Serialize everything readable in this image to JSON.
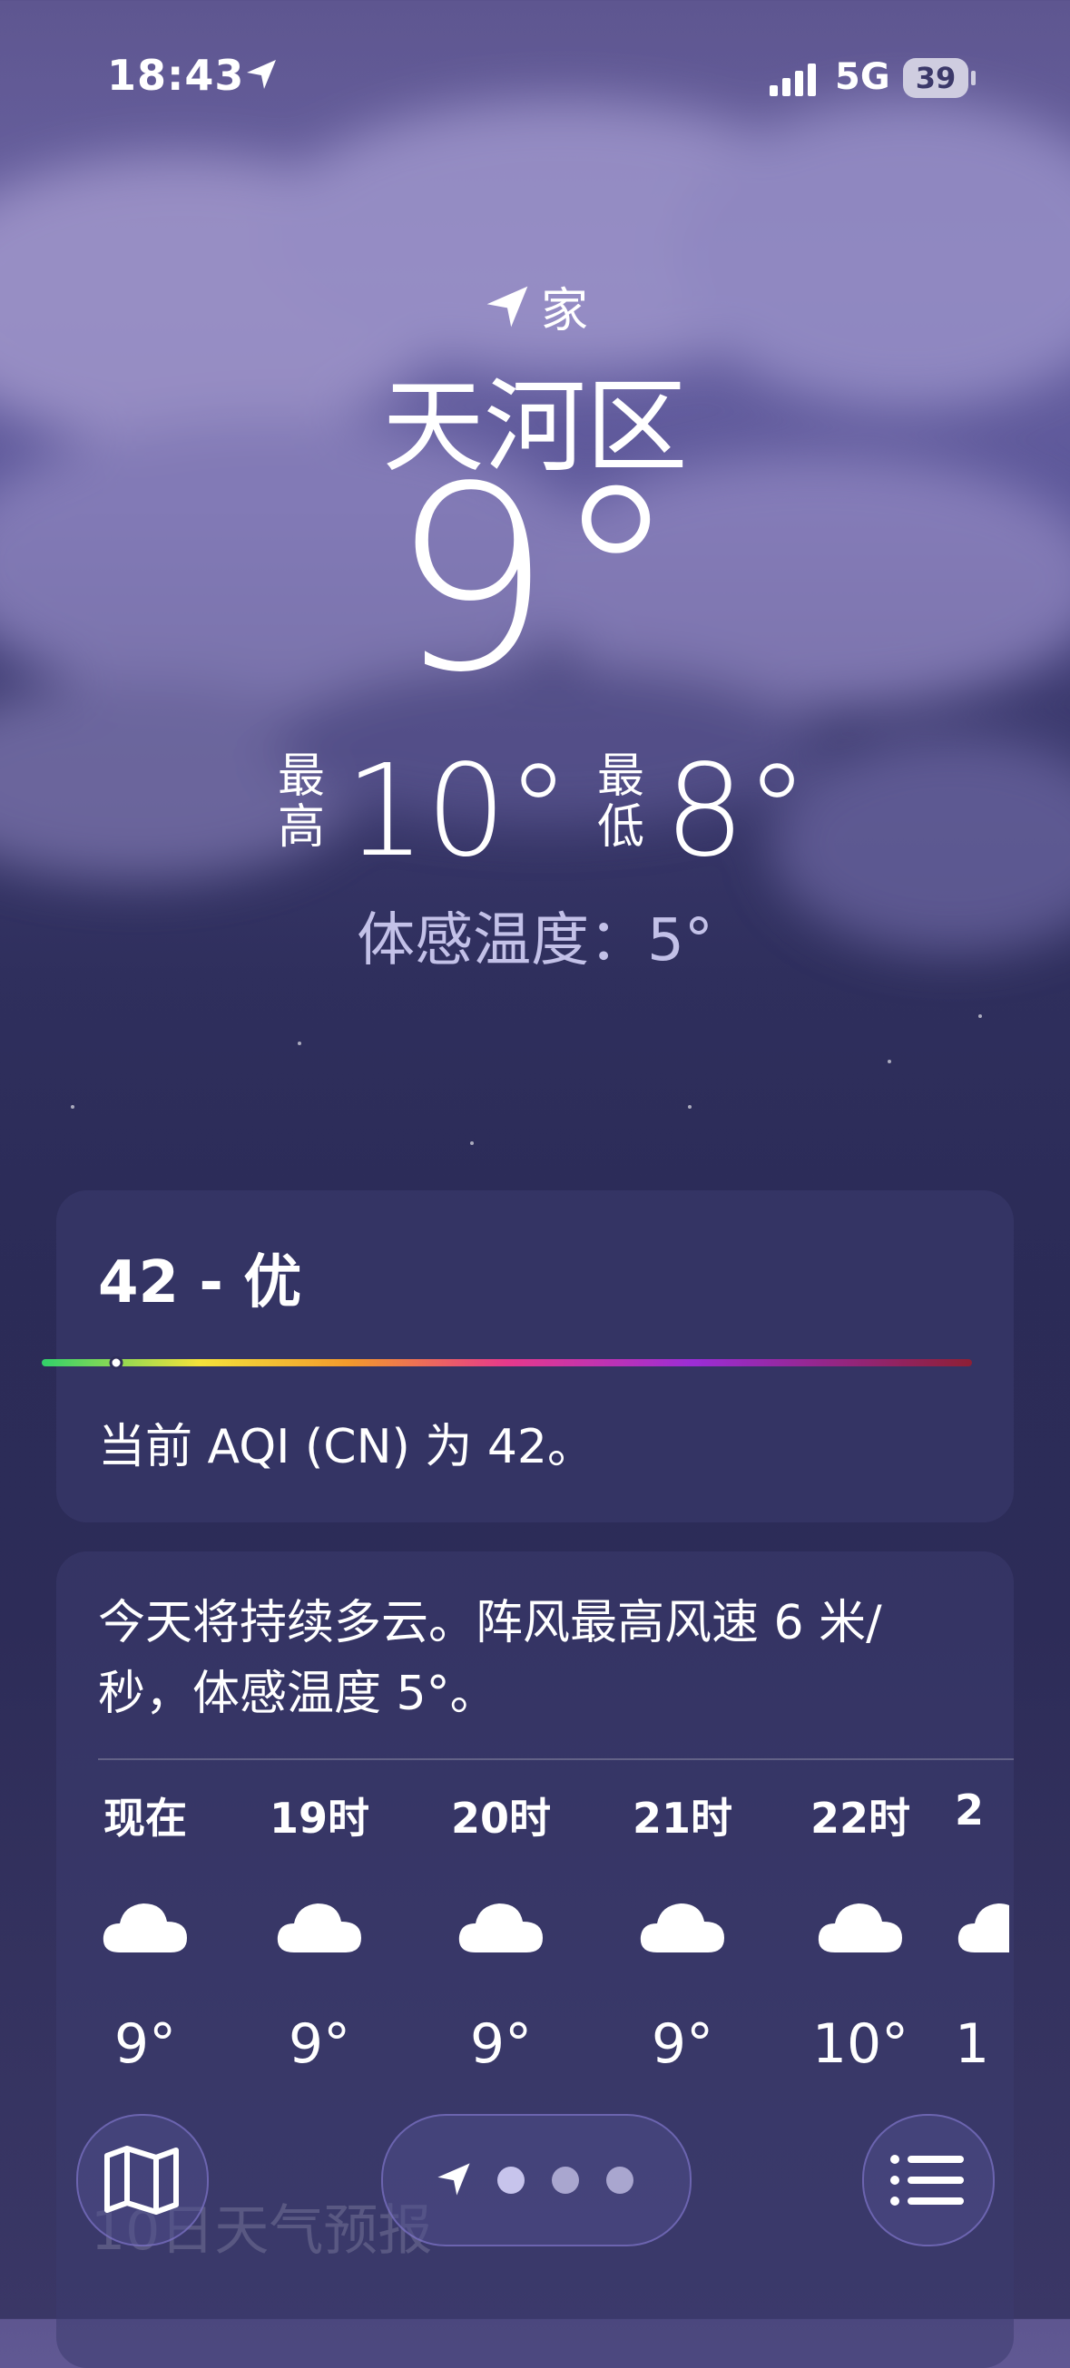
{
  "status_bar": {
    "time": "18:43",
    "network": "5G",
    "battery": "39"
  },
  "header": {
    "location_label": "家",
    "city": "天河区",
    "temperature": "9°",
    "high_label": "最高",
    "high_value": "10°",
    "low_label": "最低",
    "low_value": "8°",
    "feels_like": "体感温度：5°"
  },
  "aqi": {
    "title": "42 - 优",
    "level_fraction": 0.08,
    "description": "当前 AQI (CN) 为 42。"
  },
  "forecast": {
    "summary": "今天将持续多云。阵风最高风速 6 米/秒，体感温度 5°。",
    "hours": [
      {
        "label": "现在",
        "icon": "cloud-icon",
        "temp": "9°"
      },
      {
        "label": "19时",
        "icon": "cloud-icon",
        "temp": "9°"
      },
      {
        "label": "20时",
        "icon": "cloud-icon",
        "temp": "9°"
      },
      {
        "label": "21时",
        "icon": "cloud-icon",
        "temp": "9°"
      },
      {
        "label": "22时",
        "icon": "cloud-icon",
        "temp": "10°"
      },
      {
        "label": "2",
        "icon": "cloud-icon",
        "temp": "1"
      }
    ]
  },
  "background_text": "10日天气预报",
  "toolbar": {
    "page_count": 3,
    "active_page": 0
  }
}
